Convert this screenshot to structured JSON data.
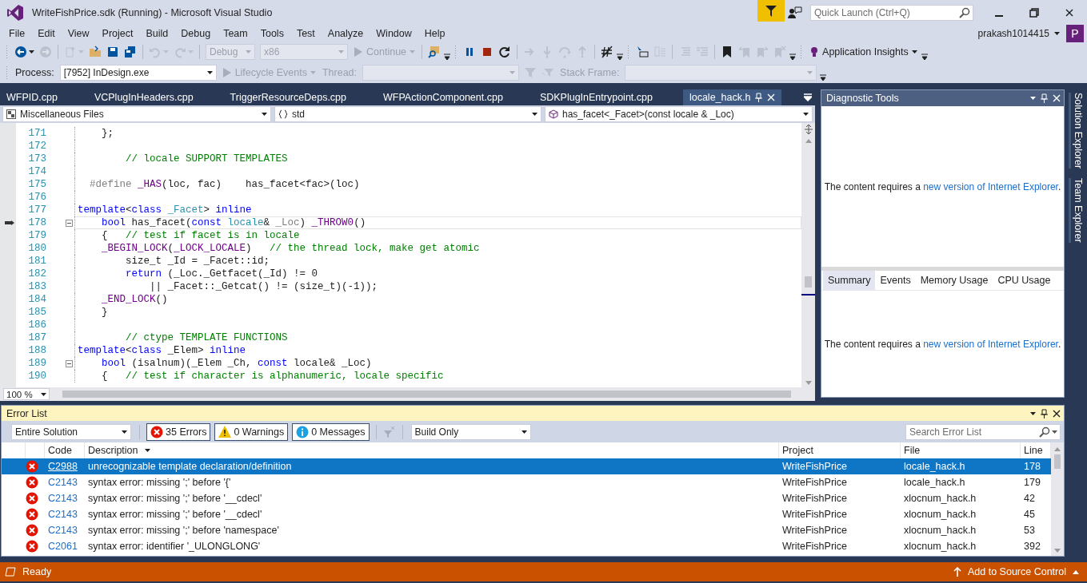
{
  "window": {
    "title": "WriteFishPrice.sdk (Running) - Microsoft Visual Studio",
    "quick_launch": {
      "placeholder": "Quick Launch (Ctrl+Q)"
    }
  },
  "menu": [
    "File",
    "Edit",
    "View",
    "Project",
    "Build",
    "Debug",
    "Team",
    "Tools",
    "Test",
    "Analyze",
    "Window",
    "Help"
  ],
  "account": {
    "name": "prakash1014415",
    "initial": "P"
  },
  "toolbar_1": [
    {
      "kind": "grip"
    },
    {
      "kind": "icon",
      "disabled": false,
      "caret": true
    },
    {
      "kind": "icon",
      "disabled": true,
      "caret": false
    },
    {
      "kind": "sep"
    },
    {
      "kind": "icon",
      "disabled": true,
      "caret": true
    },
    {
      "kind": "icon",
      "disabled": false,
      "caret": false
    },
    {
      "kind": "icon",
      "disabled": false,
      "caret": false
    },
    {
      "kind": "icon",
      "disabled": false,
      "caret": false
    },
    {
      "kind": "sep"
    },
    {
      "kind": "icon",
      "disabled": true,
      "caret": true
    },
    {
      "kind": "icon",
      "disabled": true,
      "caret": true
    },
    {
      "kind": "sep"
    },
    {
      "kind": "combo",
      "text": "Debug",
      "disabled": true
    },
    {
      "kind": "combo",
      "text": "x86",
      "disabled": true
    },
    {
      "kind": "button",
      "text": "Continue",
      "disabled": true,
      "caret": true
    },
    {
      "kind": "sep"
    },
    {
      "kind": "icon",
      "disabled": false,
      "caret": false
    },
    {
      "kind": "overflow"
    },
    {
      "kind": "grip"
    },
    {
      "kind": "icon",
      "disabled": false,
      "caret": false
    },
    {
      "kind": "icon",
      "disabled": false,
      "caret": false
    },
    {
      "kind": "icon",
      "disabled": false,
      "caret": false
    },
    {
      "kind": "sep"
    },
    {
      "kind": "icon",
      "disabled": true,
      "caret": false
    },
    {
      "kind": "icon",
      "disabled": true,
      "caret": false
    },
    {
      "kind": "icon",
      "disabled": true,
      "caret": false
    },
    {
      "kind": "icon",
      "disabled": true,
      "caret": false
    },
    {
      "kind": "sep"
    },
    {
      "kind": "icon",
      "disabled": false,
      "caret": false
    },
    {
      "kind": "overflow"
    },
    {
      "kind": "grip"
    },
    {
      "kind": "icon",
      "disabled": false,
      "caret": false
    },
    {
      "kind": "icon",
      "disabled": true,
      "caret": false
    },
    {
      "kind": "sep"
    },
    {
      "kind": "icon",
      "disabled": true,
      "caret": false
    },
    {
      "kind": "icon",
      "disabled": true,
      "caret": false
    },
    {
      "kind": "sep"
    },
    {
      "kind": "icon",
      "disabled": false,
      "caret": false
    },
    {
      "kind": "icon",
      "disabled": true,
      "caret": false
    },
    {
      "kind": "icon",
      "disabled": true,
      "caret": false
    },
    {
      "kind": "icon",
      "disabled": true,
      "caret": false
    },
    {
      "kind": "overflow"
    },
    {
      "kind": "grip"
    },
    {
      "kind": "button",
      "text": "Application Insights",
      "disabled": false,
      "caret": true
    },
    {
      "kind": "overflow"
    }
  ],
  "toolbar_2": [
    {
      "kind": "grip"
    },
    {
      "kind": "label",
      "text": "Process:",
      "disabled": false
    },
    {
      "kind": "combo",
      "text": "[7952] InDesign.exe",
      "disabled": false
    },
    {
      "kind": "button",
      "text": "Lifecycle Events",
      "disabled": true,
      "caret": true
    },
    {
      "kind": "label",
      "text": "Thread:",
      "disabled": true
    },
    {
      "kind": "combo",
      "disabled": true
    },
    {
      "kind": "icon",
      "disabled": true,
      "caret": false
    },
    {
      "kind": "icon",
      "disabled": true,
      "caret": false
    },
    {
      "kind": "label",
      "text": "Stack Frame:",
      "disabled": true
    },
    {
      "kind": "combo",
      "disabled": true
    },
    {
      "kind": "overflow"
    }
  ],
  "document_tabs": [
    {
      "label": "WFPID.cpp",
      "selected": false
    },
    {
      "label": "VCPlugInHeaders.cpp",
      "selected": false
    },
    {
      "label": "TriggerResourceDeps.cpp",
      "selected": false
    },
    {
      "label": "WFPActionComponent.cpp",
      "selected": false
    },
    {
      "label": "SDKPlugInEntrypoint.cpp",
      "selected": false
    },
    {
      "label": "locale_hack.h",
      "selected": true
    }
  ],
  "navigation_bar": [
    {
      "text": "Miscellaneous Files"
    },
    {
      "text": "std"
    },
    {
      "text": "has_facet<_Facet>(const locale & _Loc)"
    }
  ],
  "code_lines": [
    {
      "number": "171",
      "current": false,
      "collapsible": false,
      "tokens": [
        {
          "kind": "plain",
          "text": "    };"
        }
      ]
    },
    {
      "number": "172",
      "current": false,
      "collapsible": false
    },
    {
      "number": "173",
      "current": false,
      "collapsible": false,
      "tokens": [
        {
          "kind": "comment",
          "text": "        // locale SUPPORT TEMPLATES"
        }
      ]
    },
    {
      "number": "174",
      "current": false,
      "collapsible": false
    },
    {
      "number": "175",
      "current": false,
      "collapsible": false,
      "tokens": [
        {
          "kind": "preproc",
          "text": "  #define"
        },
        {
          "kind": "macro",
          "text": " _HAS"
        },
        {
          "kind": "plain",
          "text": "(loc, fac)    has_facet<fac>(loc)"
        }
      ]
    },
    {
      "number": "176",
      "current": false,
      "collapsible": false
    },
    {
      "number": "177",
      "current": false,
      "collapsible": false,
      "tokens": [
        {
          "kind": "keyword",
          "text": "template"
        },
        {
          "kind": "plain",
          "text": "<"
        },
        {
          "kind": "keyword",
          "text": "class"
        },
        {
          "kind": "type",
          "text": " _Facet"
        },
        {
          "kind": "plain",
          "text": "> "
        },
        {
          "kind": "keyword",
          "text": "inline"
        }
      ]
    },
    {
      "number": "178",
      "current": true,
      "collapsible": true,
      "tokens": [
        {
          "kind": "keyword",
          "text": "    bool"
        },
        {
          "kind": "plain",
          "text": " has_facet("
        },
        {
          "kind": "keyword",
          "text": "const"
        },
        {
          "kind": "type",
          "text": " locale"
        },
        {
          "kind": "plain",
          "text": "& "
        },
        {
          "kind": "param",
          "text": "_Loc"
        },
        {
          "kind": "plain",
          "text": ") "
        },
        {
          "kind": "macro",
          "text": "_THROW0"
        },
        {
          "kind": "plain",
          "text": "()"
        }
      ]
    },
    {
      "number": "179",
      "current": false,
      "collapsible": false,
      "tokens": [
        {
          "kind": "plain",
          "text": "    {   "
        },
        {
          "kind": "comment",
          "text": "// test if facet is in locale"
        }
      ]
    },
    {
      "number": "180",
      "current": false,
      "collapsible": false,
      "tokens": [
        {
          "kind": "macro",
          "text": "    _BEGIN_LOCK"
        },
        {
          "kind": "plain",
          "text": "("
        },
        {
          "kind": "macro",
          "text": "_LOCK_LOCALE"
        },
        {
          "kind": "plain",
          "text": ")   "
        },
        {
          "kind": "comment",
          "text": "// the thread lock, make get atomic"
        }
      ]
    },
    {
      "number": "181",
      "current": false,
      "collapsible": false,
      "tokens": [
        {
          "kind": "plain",
          "text": "        size_t _Id = _Facet::id;"
        }
      ]
    },
    {
      "number": "182",
      "current": false,
      "collapsible": false,
      "tokens": [
        {
          "kind": "keyword",
          "text": "        return"
        },
        {
          "kind": "plain",
          "text": " (_Loc._Getfacet(_Id) != 0"
        }
      ]
    },
    {
      "number": "183",
      "current": false,
      "collapsible": false,
      "tokens": [
        {
          "kind": "plain",
          "text": "            || _Facet::_Getcat() != (size_t)(-1));"
        }
      ]
    },
    {
      "number": "184",
      "current": false,
      "collapsible": false,
      "tokens": [
        {
          "kind": "macro",
          "text": "    _END_LOCK"
        },
        {
          "kind": "plain",
          "text": "()"
        }
      ]
    },
    {
      "number": "185",
      "current": false,
      "collapsible": false,
      "tokens": [
        {
          "kind": "plain",
          "text": "    }"
        }
      ]
    },
    {
      "number": "186",
      "current": false,
      "collapsible": false
    },
    {
      "number": "187",
      "current": false,
      "collapsible": false,
      "tokens": [
        {
          "kind": "comment",
          "text": "        // ctype TEMPLATE FUNCTIONS"
        }
      ]
    },
    {
      "number": "188",
      "current": false,
      "collapsible": false,
      "tokens": [
        {
          "kind": "keyword",
          "text": "template"
        },
        {
          "kind": "plain",
          "text": "<"
        },
        {
          "kind": "keyword",
          "text": "class"
        },
        {
          "kind": "plain",
          "text": " _Elem> "
        },
        {
          "kind": "keyword",
          "text": "inline"
        }
      ]
    },
    {
      "number": "189",
      "current": false,
      "collapsible": true,
      "tokens": [
        {
          "kind": "keyword",
          "text": "    bool"
        },
        {
          "kind": "plain",
          "text": " (isalnum)(_Elem _Ch, "
        },
        {
          "kind": "keyword",
          "text": "const"
        },
        {
          "kind": "plain",
          "text": " locale& _Loc)"
        }
      ]
    },
    {
      "number": "190",
      "current": false,
      "collapsible": false,
      "tokens": [
        {
          "kind": "plain",
          "text": "    {   "
        },
        {
          "kind": "comment",
          "text": "// test if character is alphanumeric, locale specific"
        }
      ]
    }
  ],
  "zoom": "100 %",
  "diagnostic_tools": {
    "title": "Diagnostic Tools",
    "message": {
      "text": "The content requires a ",
      "link": "new version of Internet Explorer",
      "after": "."
    },
    "tabs": [
      {
        "label": "Summary",
        "selected": true
      },
      {
        "label": "Events",
        "selected": false
      },
      {
        "label": "Memory Usage",
        "selected": false
      },
      {
        "label": "CPU Usage",
        "selected": false
      }
    ],
    "tab_message": {
      "text": "The content requires a ",
      "link": "new version of Internet Explorer",
      "after": "."
    }
  },
  "side_tabs": [
    "Solution Explorer",
    "Team Explorer"
  ],
  "error_list": {
    "title": "Error List",
    "scope": "Entire Solution",
    "filters": [
      {
        "kind": "error",
        "label": "35 Errors",
        "selected": true
      },
      {
        "kind": "warning",
        "label": "0 Warnings",
        "selected": true
      },
      {
        "kind": "message",
        "label": "0 Messages",
        "selected": true
      }
    ],
    "build_filter": "Build Only",
    "search": {
      "placeholder": "Search Error List"
    },
    "columns": [
      "Code",
      "Description",
      "Project",
      "File",
      "Line"
    ],
    "rows": [
      {
        "code": "C2988",
        "description": "unrecognizable template declaration/definition",
        "project": "WriteFishPrice",
        "file": "locale_hack.h",
        "line": "178",
        "selected": true
      },
      {
        "code": "C2143",
        "description": "syntax error: missing ';' before '{'",
        "project": "WriteFishPrice",
        "file": "locale_hack.h",
        "line": "179",
        "selected": false
      },
      {
        "code": "C2143",
        "description": "syntax error: missing ';' before '__cdecl'",
        "project": "WriteFishPrice",
        "file": "xlocnum_hack.h",
        "line": "42",
        "selected": false
      },
      {
        "code": "C2143",
        "description": "syntax error: missing ';' before '__cdecl'",
        "project": "WriteFishPrice",
        "file": "xlocnum_hack.h",
        "line": "45",
        "selected": false
      },
      {
        "code": "C2143",
        "description": "syntax error: missing ';' before 'namespace'",
        "project": "WriteFishPrice",
        "file": "xlocnum_hack.h",
        "line": "53",
        "selected": false
      },
      {
        "code": "C2061",
        "description": "syntax error: identifier '_ULONGLONG'",
        "project": "WriteFishPrice",
        "file": "xlocnum_hack.h",
        "line": "392",
        "selected": false
      }
    ]
  },
  "status_bar": {
    "text": "Ready",
    "source_control": "Add to Source Control"
  }
}
